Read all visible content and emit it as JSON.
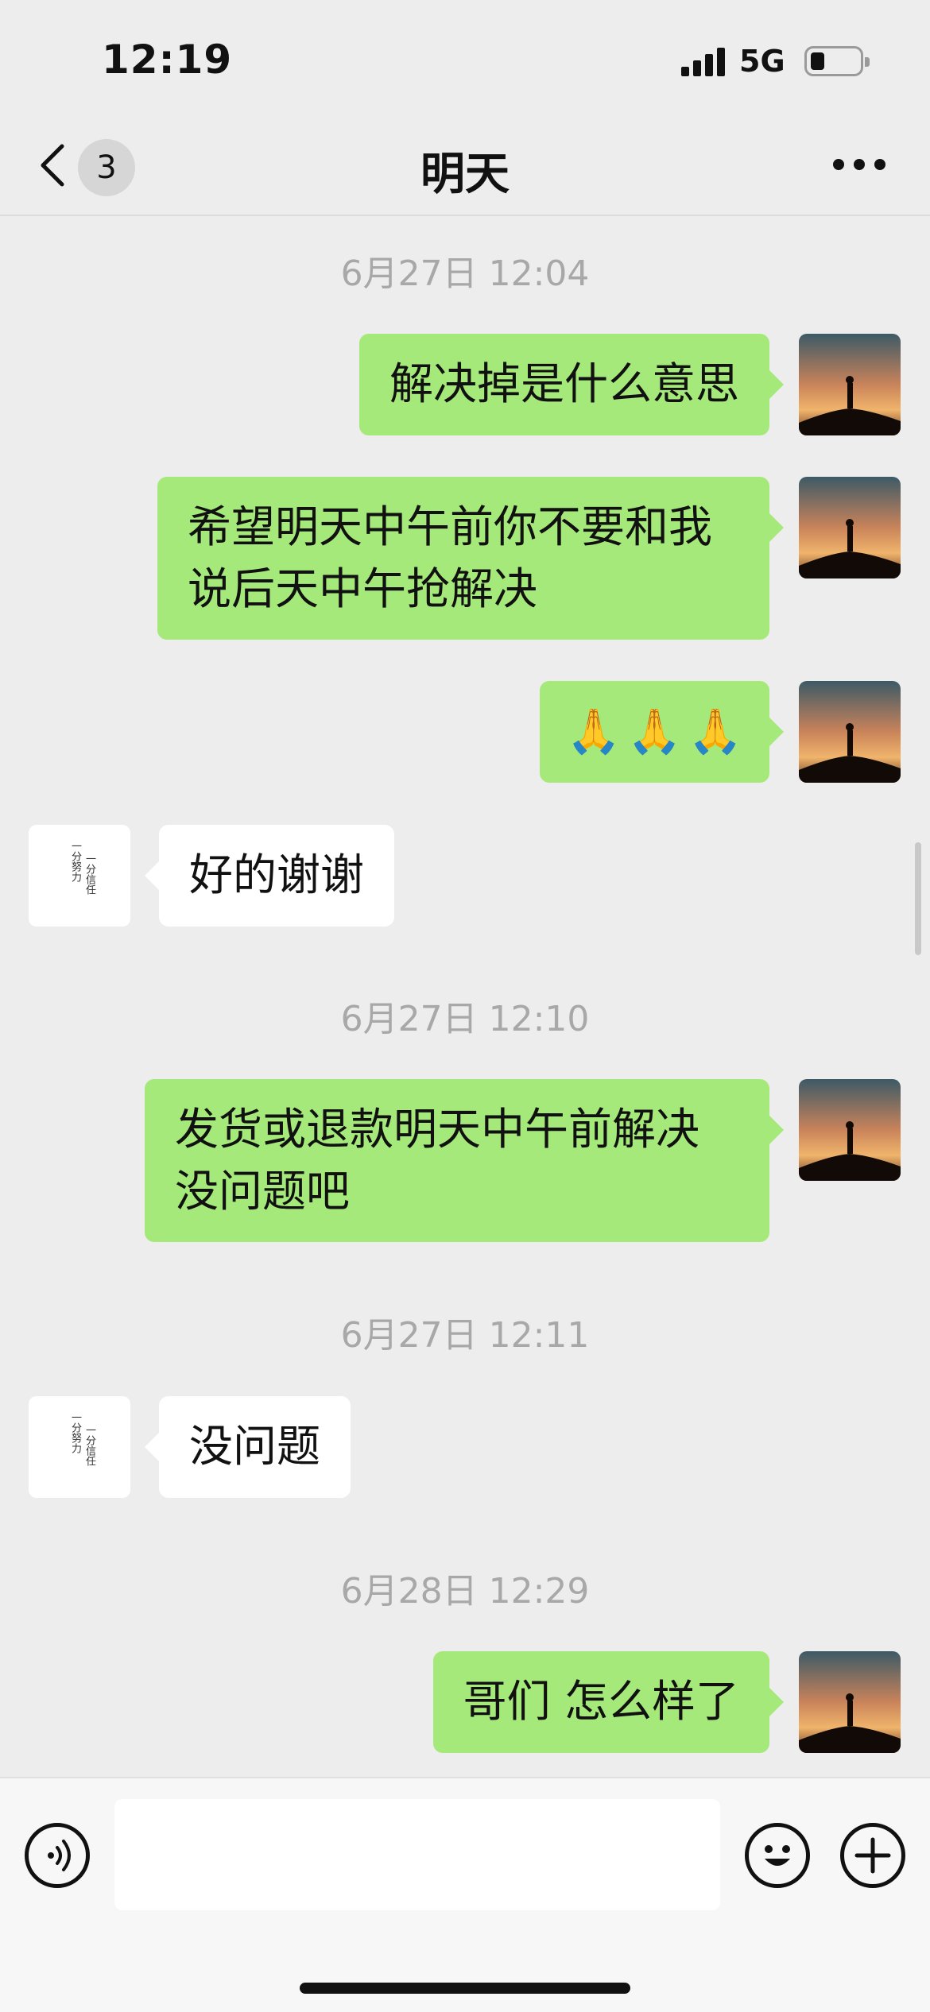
{
  "status": {
    "time": "12:19",
    "network": "5G"
  },
  "nav": {
    "unread_count": "3",
    "title": "明天"
  },
  "messages": [
    {
      "type": "timestamp",
      "text": "6月27日 12:04"
    },
    {
      "type": "sent",
      "text": "解决掉是什么意思"
    },
    {
      "type": "sent",
      "text": "希望明天中午前你不要和我说后天中午抢解决"
    },
    {
      "type": "sent",
      "emoji": [
        "🙏",
        "🙏",
        "🙏"
      ]
    },
    {
      "type": "received",
      "text": "好的谢谢"
    },
    {
      "type": "timestamp",
      "text": "6月27日 12:10"
    },
    {
      "type": "sent",
      "text": "发货或退款明天中午前解决没问题吧"
    },
    {
      "type": "timestamp",
      "text": "6月27日 12:11"
    },
    {
      "type": "received",
      "text": "没问题"
    },
    {
      "type": "timestamp",
      "text": "6月28日 12:29"
    },
    {
      "type": "sent",
      "text": "哥们 怎么样了"
    }
  ],
  "contact_avatar_text": {
    "line1": "一分努力",
    "line2": "一分信任"
  },
  "input": {
    "value": ""
  },
  "colors": {
    "sent_bubble": "#a5e97a",
    "received_bubble": "#ffffff",
    "background": "#ededed"
  }
}
